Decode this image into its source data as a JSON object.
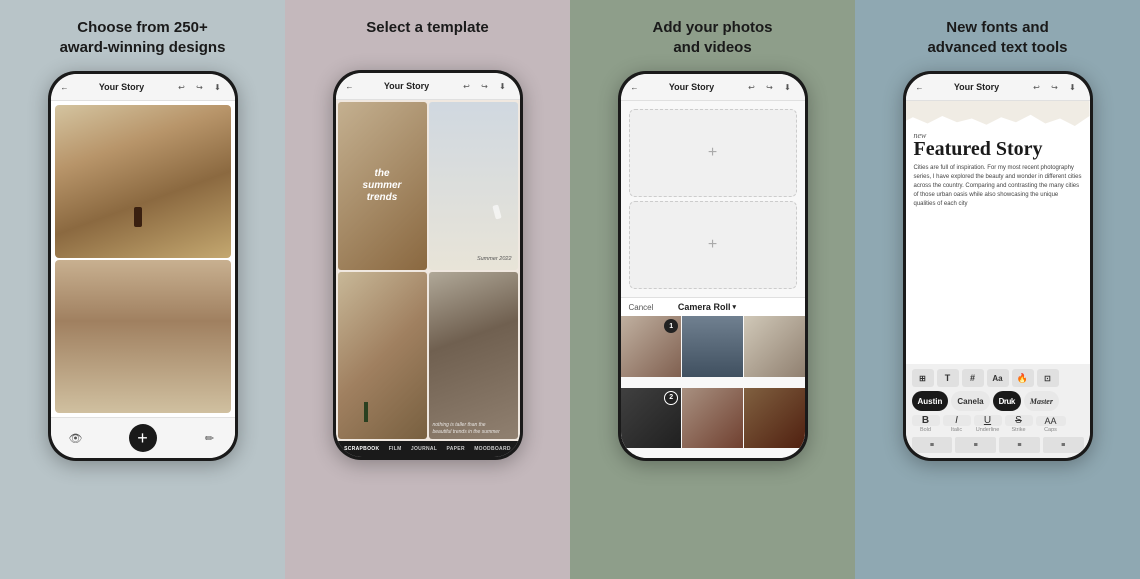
{
  "panels": [
    {
      "id": "panel-1",
      "bg": "panel-1",
      "title": "Choose from 250+\naward-winning designs",
      "phone": {
        "topbar": {
          "back": "←",
          "title": "Your Story",
          "undo": "↩",
          "redo": "↪",
          "download": "⬇"
        },
        "content_type": "photo-strip",
        "bottom_bar": {
          "eye_icon": "👁",
          "add_icon": "+",
          "pen_icon": "✏"
        }
      }
    },
    {
      "id": "panel-2",
      "bg": "panel-2",
      "title": "Select a template",
      "phone": {
        "topbar": {
          "back": "←",
          "title": "Your Story",
          "undo": "↩",
          "redo": "↪",
          "download": "⬇"
        },
        "content_type": "template-grid",
        "cell1_text": "the\nsummer\ntrends",
        "cell2_label": "Summer 2022",
        "cell4_caption": "nothing is taller than the\nbeautiful trends in the summer",
        "tabs": [
          "SCRAPBOOK",
          "FILM",
          "JOURNAL",
          "PAPER",
          "MOODBOARD"
        ]
      }
    },
    {
      "id": "panel-3",
      "bg": "panel-3",
      "title": "Add your photos\nand videos",
      "phone": {
        "topbar": {
          "back": "←",
          "title": "Your Story",
          "undo": "↩",
          "redo": "↪",
          "download": "⬇"
        },
        "content_type": "photo-upload",
        "picker": {
          "cancel": "Cancel",
          "title": "Camera Roll",
          "chevron": "▾"
        },
        "badge1": "1",
        "badge2": "2"
      }
    },
    {
      "id": "panel-4",
      "bg": "panel-4",
      "title": "New fonts and\nadvanced text tools",
      "phone": {
        "topbar": {
          "back": "←",
          "title": "Your Story",
          "undo": "↩",
          "redo": "↪",
          "download": "⬇"
        },
        "content_type": "text-editor",
        "canvas": {
          "new_tag": "new",
          "title": "Featured Story",
          "body": "Cities are full of inspiration. For my most recent photography series, I have explored the beauty and wonder in different cities across the country. Comparing and contrasting the many cities of those urban oasis while also showcasing the unique qualities of each city"
        },
        "fonts": [
          "Austin",
          "Canela",
          "Druk",
          "Master"
        ],
        "format_labels": [
          "Bold",
          "Italic",
          "Underline",
          "Strike",
          "Caps"
        ],
        "format_symbols": [
          "B",
          "I",
          "U",
          "S",
          "AA"
        ]
      }
    }
  ]
}
